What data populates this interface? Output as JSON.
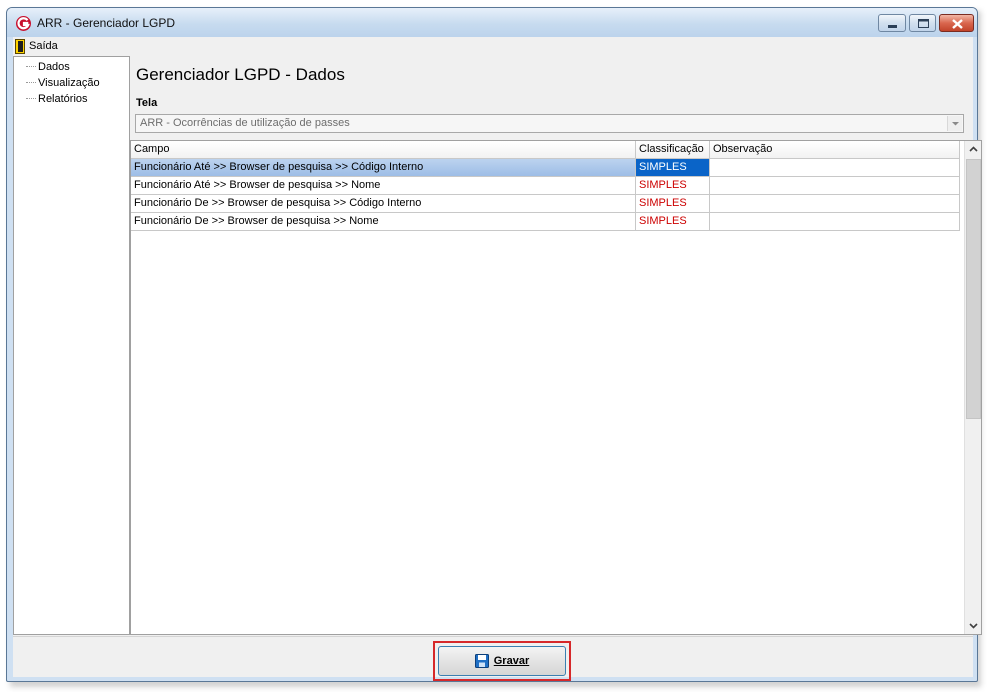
{
  "window": {
    "title": "ARR - Gerenciador LGPD",
    "icon": "app-logo-icon"
  },
  "menu": {
    "exit_label": "Saída",
    "exit_icon": "door-exit-icon"
  },
  "sidebar": {
    "items": [
      {
        "label": "Dados"
      },
      {
        "label": "Visualização"
      },
      {
        "label": "Relatórios"
      }
    ]
  },
  "main": {
    "title": "Gerenciador LGPD - Dados",
    "screen_label": "Tela",
    "screen_value": "ARR - Ocorrências de utilização de passes"
  },
  "grid": {
    "columns": [
      "Campo",
      "Classificação",
      "Observação"
    ],
    "rows": [
      {
        "campo": "Funcionário Até >> Browser de pesquisa >> Código Interno",
        "classificacao": "SIMPLES",
        "observacao": "",
        "selected": true
      },
      {
        "campo": "Funcionário Até >> Browser de pesquisa >> Nome",
        "classificacao": "SIMPLES",
        "observacao": ""
      },
      {
        "campo": "Funcionário De >> Browser de pesquisa >> Código Interno",
        "classificacao": "SIMPLES",
        "observacao": ""
      },
      {
        "campo": "Funcionário De >> Browser de pesquisa >> Nome",
        "classificacao": "SIMPLES",
        "observacao": ""
      }
    ]
  },
  "actions": {
    "save_label": "Gravar",
    "save_icon": "floppy-disk-icon"
  },
  "colors": {
    "classification_text": "#cc0000",
    "selection": "#0a64c8",
    "highlight_border": "#d6282a"
  }
}
